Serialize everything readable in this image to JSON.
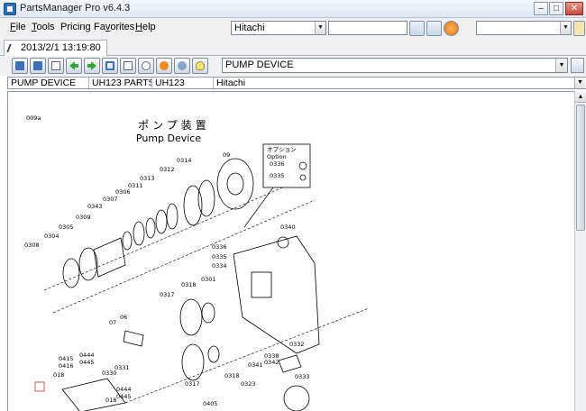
{
  "window": {
    "title": "PartsManager Pro v6.4.3"
  },
  "menu": [
    {
      "label": "File",
      "accel": "F"
    },
    {
      "label": "Tools",
      "accel": "T"
    },
    {
      "label": "Pricing",
      "accel": ""
    },
    {
      "label": "Favorites",
      "accel": "v"
    },
    {
      "label": "Help",
      "accel": "H"
    }
  ],
  "search": {
    "brand": "Hitachi",
    "query": "",
    "filter": ""
  },
  "tab": {
    "label": "2013/2/1 13:19:80"
  },
  "document": {
    "selected": "PUMP DEVICE"
  },
  "path": [
    {
      "label": "PUMP DEVICE"
    },
    {
      "label": "UH123  PARTS"
    },
    {
      "label": "UH123"
    },
    {
      "label": "Hitachi"
    }
  ],
  "drawing": {
    "page_code": "009a",
    "title_jp": "ポンプ装置",
    "title_en": "Pump Device",
    "option_jp": "オプション",
    "option_en": "Option",
    "callouts": [
      "09",
      "0314",
      "0312",
      "0313",
      "0311",
      "0306",
      "0307",
      "0343",
      "0309",
      "0305",
      "0304",
      "0308",
      "0336",
      "0335",
      "0340",
      "0334",
      "0301",
      "0317",
      "0318",
      "06",
      "07",
      "0415",
      "0416",
      "018",
      "0444",
      "0445",
      "0330",
      "0331",
      "0444",
      "0445",
      "0332",
      "0338",
      "0342",
      "0341",
      "0333",
      "0317",
      "0318",
      "0323",
      "0405",
      "018",
      "0336",
      "0335"
    ]
  },
  "icons": {
    "toolbar": [
      "print-setup-icon",
      "printer-icon",
      "back-arrow-icon",
      "forward-arrow-icon",
      "zoom-fit-icon",
      "page-icon",
      "zoom-icon",
      "info-icon",
      "settings-icon",
      "hint-bulb-icon"
    ]
  }
}
